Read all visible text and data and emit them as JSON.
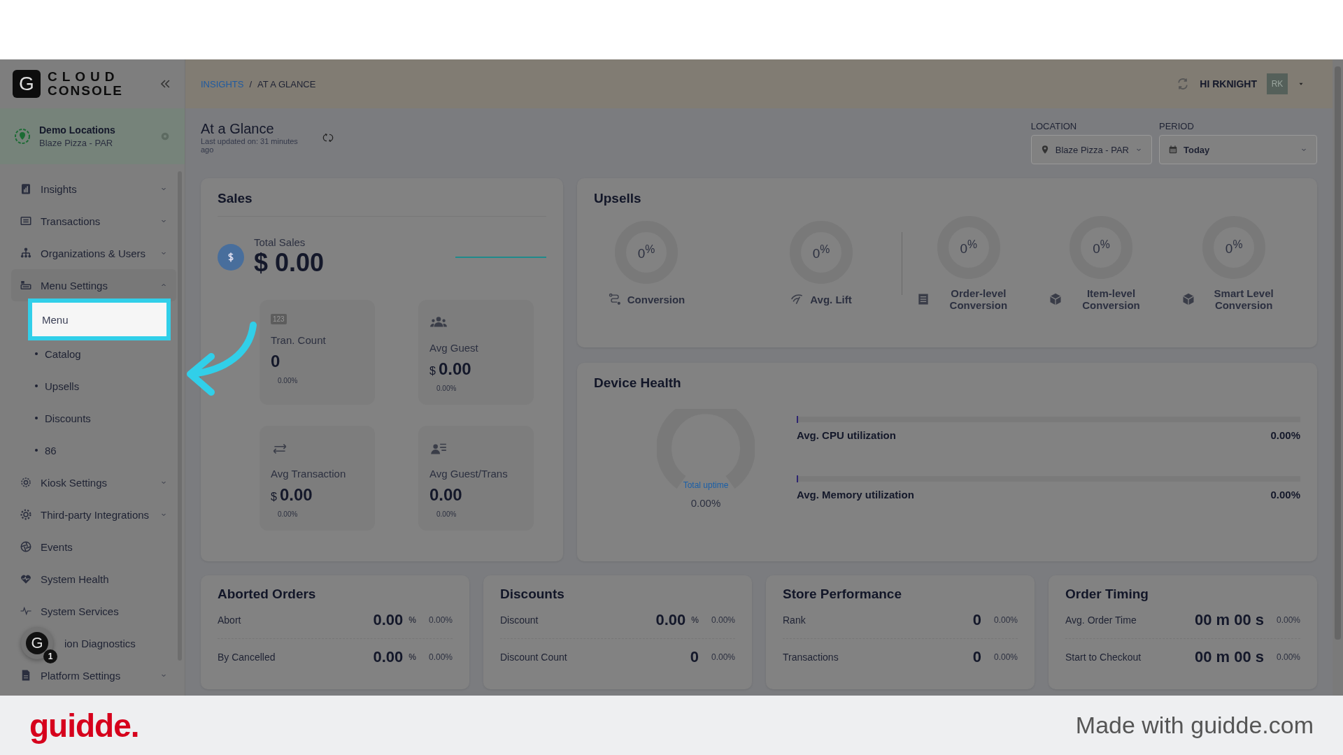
{
  "sidebar": {
    "logo_mark": "G",
    "logo_top": "CLOUD",
    "logo_bottom": "CONSOLE",
    "location": {
      "name": "Demo Locations",
      "sub": "Blaze Pizza - PAR"
    },
    "items": [
      {
        "label": "Insights",
        "kind": "group",
        "expanded": false
      },
      {
        "label": "Transactions",
        "kind": "group",
        "expanded": false
      },
      {
        "label": "Organizations & Users",
        "kind": "group",
        "expanded": false
      },
      {
        "label": "Menu Settings",
        "kind": "group",
        "expanded": true,
        "children": [
          {
            "label": "Menu",
            "selected": true
          },
          {
            "label": "Catalog",
            "selected": false
          },
          {
            "label": "Upsells",
            "selected": false
          },
          {
            "label": "Discounts",
            "selected": false
          },
          {
            "label": "86",
            "selected": false
          }
        ]
      },
      {
        "label": "Kiosk Settings",
        "kind": "group",
        "expanded": false
      },
      {
        "label": "Third-party Integrations",
        "kind": "group",
        "expanded": false
      },
      {
        "label": "Events",
        "kind": "link"
      },
      {
        "label": "System Health",
        "kind": "link"
      },
      {
        "label": "System Services",
        "kind": "link"
      },
      {
        "label": "ion Diagnostics",
        "kind": "link"
      },
      {
        "label": "Platform Settings",
        "kind": "group",
        "expanded": false
      }
    ],
    "help_badge": {
      "mark": "G",
      "count": "1"
    }
  },
  "header": {
    "breadcrumb": [
      "INSIGHTS",
      "AT A GLANCE"
    ],
    "separator": "/",
    "greeting": "HI RKNIGHT",
    "avatar": "RK"
  },
  "page": {
    "title": "At a Glance",
    "updated": "Last updated on: 31 minutes ago",
    "filters": [
      {
        "label": "LOCATION",
        "value": "Blaze Pizza - PAR"
      },
      {
        "label": "PERIOD",
        "value": "Today"
      }
    ]
  },
  "sales": {
    "title": "Sales",
    "total_label": "Total Sales",
    "currency": "$",
    "total": "0.00",
    "stats": [
      {
        "label": "Tran. Count",
        "badge": "123",
        "value": "0",
        "change": "0.00%"
      },
      {
        "label": "Avg Guest",
        "prefix": "$",
        "value": "0.00",
        "change": "0.00%"
      },
      {
        "label": "Avg Transaction",
        "prefix": "$",
        "value": "0.00",
        "change": "0.00%"
      },
      {
        "label": "Avg Guest/Trans",
        "value": "0.00",
        "change": "0.00%"
      }
    ]
  },
  "upsells": {
    "title": "Upsells",
    "groups": [
      [
        {
          "value": "0",
          "unit": "%",
          "label": "Conversion"
        },
        {
          "value": "0",
          "unit": "%",
          "label": "Avg. Lift"
        }
      ],
      [
        {
          "value": "0",
          "unit": "%",
          "label": "Order-level Conversion"
        },
        {
          "value": "0",
          "unit": "%",
          "label": "Item-level Conversion"
        },
        {
          "value": "0",
          "unit": "%",
          "label": "Smart Level Conversion"
        }
      ]
    ]
  },
  "device_health": {
    "title": "Device Health",
    "uptime_label": "Total uptime",
    "uptime": "0.00%",
    "meters": [
      {
        "label": "Avg. CPU utilization",
        "reading": "0.00%",
        "level": 0
      },
      {
        "label": "Avg. Memory utilization",
        "reading": "0.00%",
        "level": 0
      }
    ]
  },
  "summary_cards": [
    {
      "title": "Aborted Orders",
      "rows": [
        {
          "label": "Abort",
          "value": "0.00",
          "unit": "%",
          "change": "0.00%"
        },
        {
          "label": "By Cancelled",
          "value": "0.00",
          "unit": "%",
          "change": "0.00%"
        }
      ]
    },
    {
      "title": "Discounts",
      "rows": [
        {
          "label": "Discount",
          "value": "0.00",
          "unit": "%",
          "change": "0.00%"
        },
        {
          "label": "Discount Count",
          "value": "0",
          "change": "0.00%"
        }
      ]
    },
    {
      "title": "Store Performance",
      "rows": [
        {
          "label": "Rank",
          "value": "0",
          "change": "0.00%"
        },
        {
          "label": "Transactions",
          "value": "0",
          "change": "0.00%"
        }
      ]
    },
    {
      "title": "Order Timing",
      "rows": [
        {
          "label": "Avg. Order Time",
          "value": "00 m 00 s",
          "change": "0.00%"
        },
        {
          "label": "Start to Checkout",
          "value": "00 m 00 s",
          "change": "0.00%"
        }
      ]
    }
  ],
  "footer": {
    "brand": "guidde.",
    "credit": "Made with guidde.com"
  }
}
